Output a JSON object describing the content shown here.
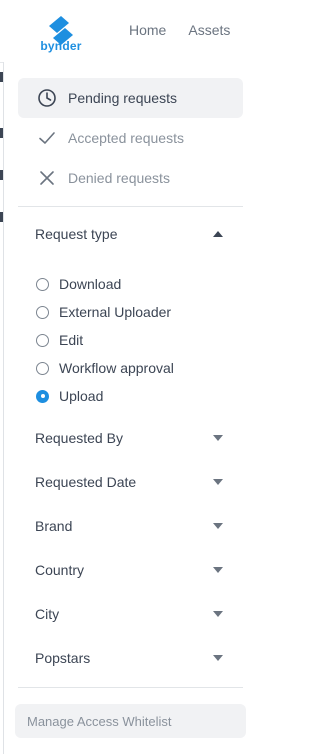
{
  "brand": {
    "name": "bynder"
  },
  "topnav": {
    "items": [
      "Home",
      "Assets"
    ]
  },
  "tabs": [
    {
      "label": "Pending requests",
      "icon": "clock-icon",
      "active": true
    },
    {
      "label": "Accepted requests",
      "icon": "check-icon",
      "active": false
    },
    {
      "label": "Denied requests",
      "icon": "close-icon",
      "active": false
    }
  ],
  "request_type": {
    "label": "Request type",
    "options": [
      {
        "label": "Download",
        "checked": false
      },
      {
        "label": "External Uploader",
        "checked": false
      },
      {
        "label": "Edit",
        "checked": false
      },
      {
        "label": "Workflow approval",
        "checked": false
      },
      {
        "label": "Upload",
        "checked": true
      }
    ]
  },
  "filters": [
    {
      "label": "Requested By"
    },
    {
      "label": "Requested Date"
    },
    {
      "label": "Brand"
    },
    {
      "label": "Country"
    },
    {
      "label": "City"
    },
    {
      "label": "Popstars"
    }
  ],
  "footer": {
    "whitelist_label": "Manage Access Whitelist"
  },
  "colors": {
    "accent": "#1e8fe0",
    "active_bg": "#f1f2f4",
    "text": "#3c4554",
    "muted": "#8a929c"
  }
}
